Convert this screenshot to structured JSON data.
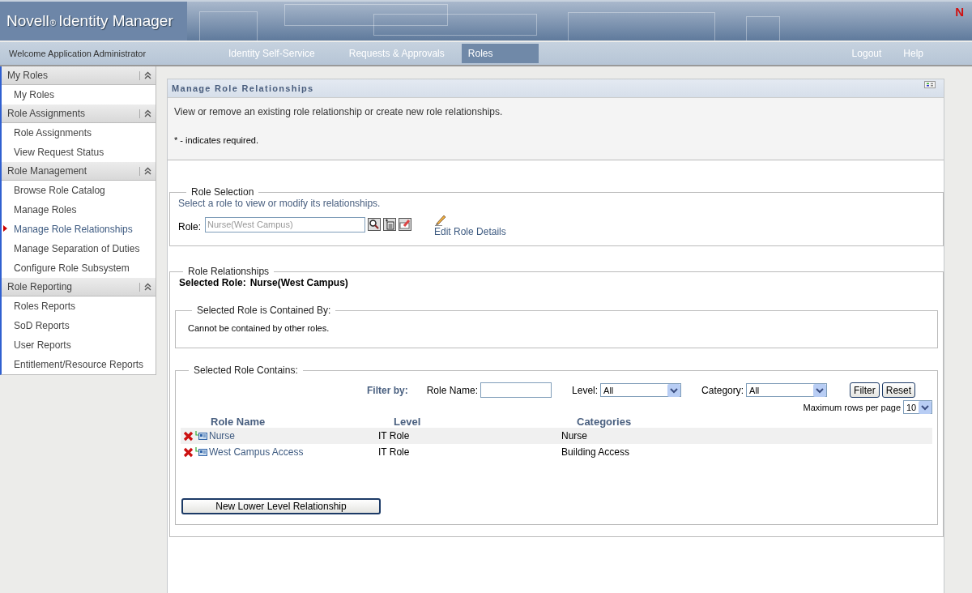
{
  "header": {
    "brand": "Novell",
    "brand_mark": "®",
    "product": "Identity Manager",
    "logo_letter": "N"
  },
  "nav": {
    "welcome": "Welcome Application Administrator",
    "tabs": [
      {
        "label": "Identity Self-Service",
        "selected": false
      },
      {
        "label": "Requests & Approvals",
        "selected": false
      },
      {
        "label": "Roles",
        "selected": true
      }
    ],
    "links": [
      "Logout",
      "Help"
    ]
  },
  "sidebar": [
    {
      "title": "My Roles",
      "expanded": true,
      "items": [
        {
          "label": "My Roles",
          "selected": false
        }
      ]
    },
    {
      "title": "Role Assignments",
      "expanded": true,
      "items": [
        {
          "label": "Role Assignments",
          "selected": false
        },
        {
          "label": "View Request Status",
          "selected": false
        }
      ]
    },
    {
      "title": "Role Management",
      "expanded": true,
      "items": [
        {
          "label": "Browse Role Catalog",
          "selected": false
        },
        {
          "label": "Manage Roles",
          "selected": false
        },
        {
          "label": "Manage Role Relationships",
          "selected": true
        },
        {
          "label": "Manage Separation of Duties",
          "selected": false
        },
        {
          "label": "Configure Role Subsystem",
          "selected": false
        }
      ]
    },
    {
      "title": "Role Reporting",
      "expanded": true,
      "items": [
        {
          "label": "Roles Reports",
          "selected": false
        },
        {
          "label": "SoD Reports",
          "selected": false
        },
        {
          "label": "User Reports",
          "selected": false
        },
        {
          "label": "Entitlement/Resource Reports",
          "selected": false
        }
      ]
    }
  ],
  "panel": {
    "title": "Manage Role Relationships",
    "description": "View or remove an existing role relationship or create new role relationships.",
    "required_note": "* - indicates required.",
    "role_selection": {
      "legend": "Role Selection",
      "hint": "Select a role to view or modify its relationships.",
      "label": "Role:",
      "value": "Nurse(West Campus)",
      "disabled": true,
      "edit_link": "Edit Role Details"
    },
    "relationships": {
      "legend": "Role Relationships",
      "selected_label": "Selected Role:",
      "selected_value": "Nurse(West Campus)",
      "contained_by": {
        "legend": "Selected Role is Contained By:",
        "message": "Cannot be contained by other roles."
      },
      "contains": {
        "legend": "Selected Role Contains:",
        "filter_label": "Filter by:",
        "role_name_label": "Role Name:",
        "level_label": "Level:",
        "level_value": "All",
        "category_label": "Category:",
        "category_value": "All",
        "filter_button": "Filter",
        "reset_button": "Reset",
        "max_rows_label": "Maximum rows per page",
        "max_rows_value": "10",
        "columns": [
          "Role Name",
          "Level",
          "Categories"
        ],
        "rows": [
          {
            "name": "Nurse",
            "level": "IT Role",
            "categories": "Nurse"
          },
          {
            "name": "West Campus Access",
            "level": "IT Role",
            "categories": "Building Access"
          }
        ],
        "new_button": "New Lower Level Relationship"
      }
    }
  }
}
